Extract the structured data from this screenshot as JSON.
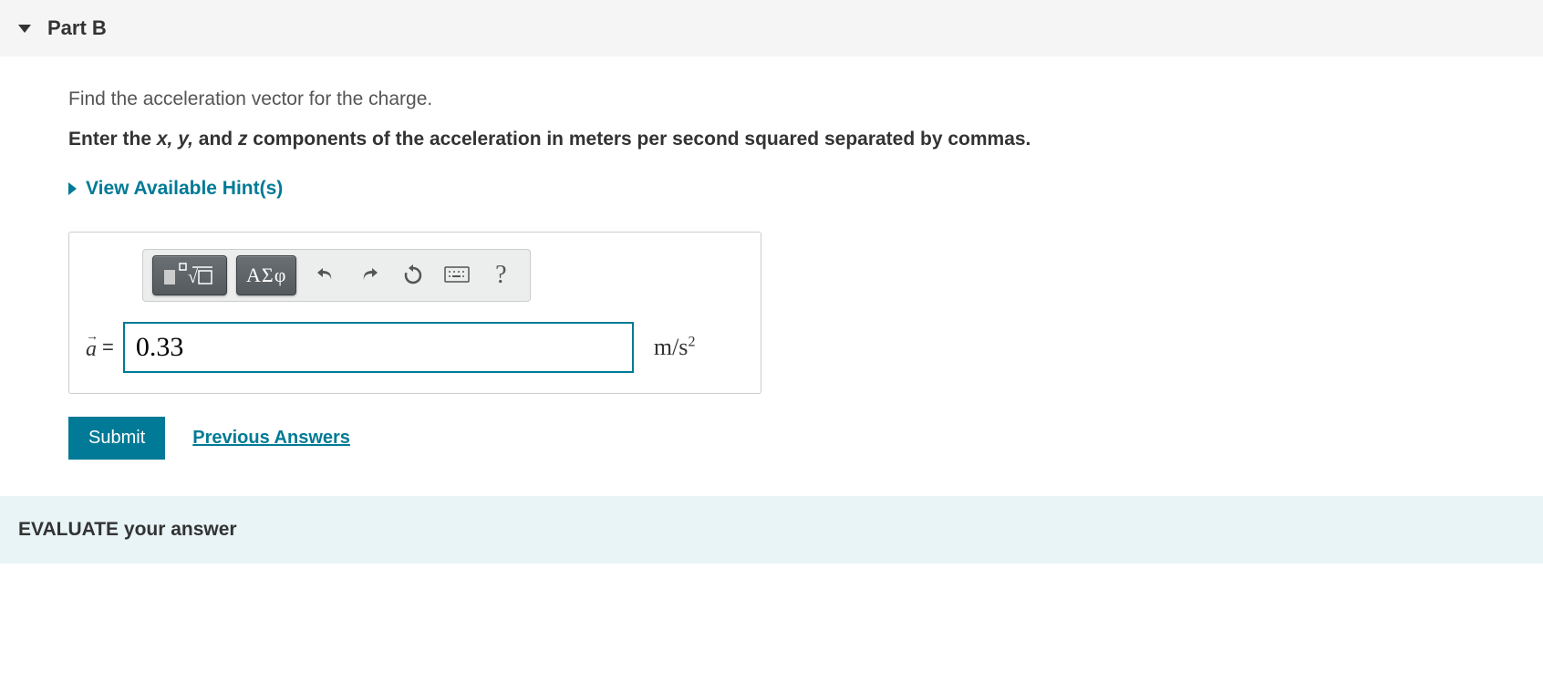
{
  "part": {
    "label": "Part B"
  },
  "question": "Find the acceleration vector for the charge.",
  "instruction_prefix": "Enter the ",
  "instruction_vars": "x, y, ",
  "instruction_and": "and ",
  "instruction_z": "z",
  "instruction_suffix": " components of the acceleration in meters per second squared separated by commas.",
  "hints": {
    "label": "View Available Hint(s)"
  },
  "toolbar": {
    "greek": "ΑΣφ",
    "help": "?"
  },
  "input": {
    "var": "a",
    "arrow": "→",
    "equals": "=",
    "value": "0.33",
    "unit_prefix": "m/s",
    "unit_exp": "2"
  },
  "actions": {
    "submit": "Submit",
    "previous": "Previous Answers"
  },
  "evaluate": "EVALUATE your answer"
}
